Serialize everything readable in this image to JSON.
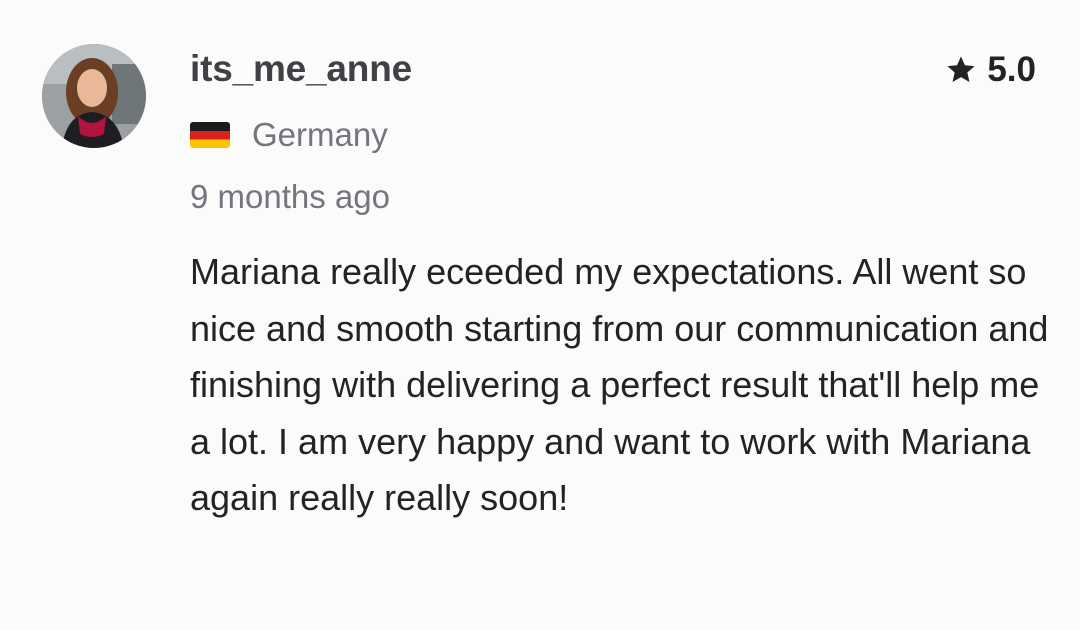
{
  "reviewer": {
    "username": "its_me_anne",
    "country": "Germany",
    "country_flag_icon": "germany-flag-icon",
    "avatar_icon": "profile-photo"
  },
  "rating": {
    "icon": "star-icon",
    "value": "5.0"
  },
  "timestamp": "9 months ago",
  "review_text": "Mariana really eceeded my expectations. All went so nice and smooth starting from our communication and finishing with delivering a perfect result that'll help me a lot. I am very happy and want to work with Mariana again really really soon!",
  "colors": {
    "username": "#404145",
    "secondary_text": "#74767e",
    "body_text": "#222325",
    "background": "#fbfbfb"
  }
}
